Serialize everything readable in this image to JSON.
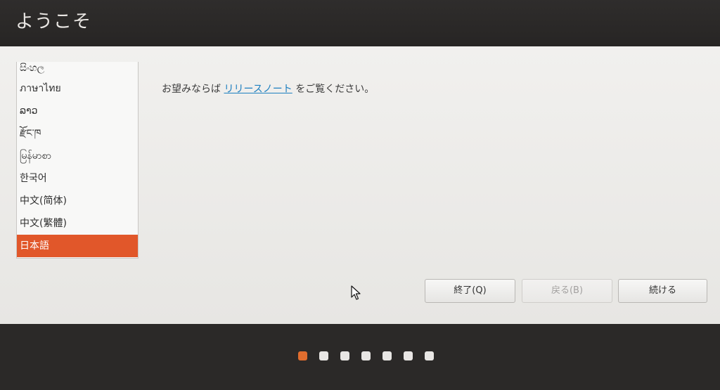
{
  "window": {
    "title": "ようこそ"
  },
  "languages": [
    {
      "label": "සිංහල",
      "selected": false
    },
    {
      "label": "ภาษาไทย",
      "selected": false
    },
    {
      "label": "ລາວ",
      "selected": false
    },
    {
      "label": "རྫོང་ཁ",
      "selected": false
    },
    {
      "label": "မြန်မာစာ",
      "selected": false
    },
    {
      "label": "한국어",
      "selected": false
    },
    {
      "label": "中文(简体)",
      "selected": false
    },
    {
      "label": "中文(繁體)",
      "selected": false
    },
    {
      "label": "日本語",
      "selected": true
    }
  ],
  "release_note": {
    "prefix": "お望みならば ",
    "link": "リリースノート",
    "suffix": " をご覧ください。"
  },
  "buttons": {
    "quit": "終了(Q)",
    "back": "戻る(B)",
    "continue": "続ける"
  },
  "progress": {
    "total_steps": 7,
    "current_step": 1
  },
  "colors": {
    "accent": "#e1572a",
    "link": "#1d7fbf"
  },
  "icons": {
    "cursor": "mouse-pointer-icon"
  }
}
